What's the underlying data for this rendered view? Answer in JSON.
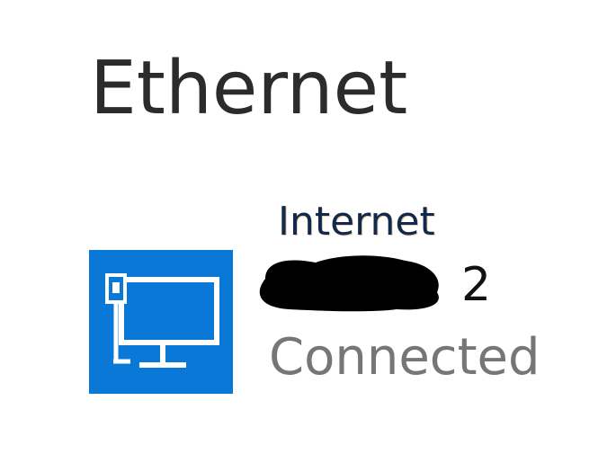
{
  "header": {
    "title": "Ethernet"
  },
  "network": {
    "link_label": "Internet",
    "name_suffix": "2",
    "status": "Connected",
    "icon": "ethernet-monitor-icon",
    "name_redacted": true
  },
  "colors": {
    "icon_tile": "#0a78d7",
    "icon_glyph": "#ffffff",
    "title_text": "#2b2b2b",
    "status_text": "#767676",
    "redaction": "#000000"
  }
}
